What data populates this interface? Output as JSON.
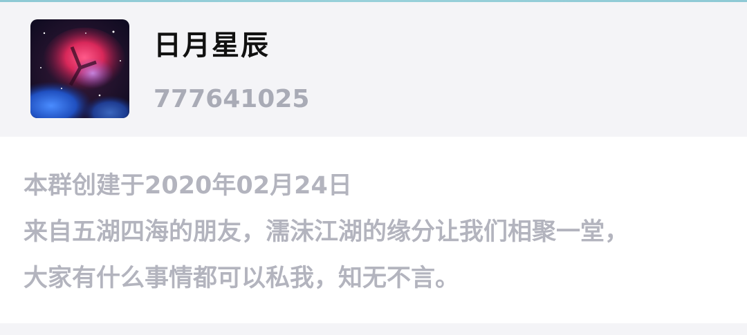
{
  "group": {
    "name": "日月星辰",
    "id": "777641025",
    "avatar_icon": "nebula-avatar"
  },
  "intro": {
    "line1": "本群创建于2020年02月24日",
    "line2": "来自五湖四海的朋友，濡沫江湖的缘分让我们相聚一堂，",
    "line3": "大家有什么事情都可以私我，知无不言。"
  },
  "colors": {
    "header_bg": "#f4f4f7",
    "card_bg": "#ffffff",
    "name_text": "#111111",
    "secondary_text": "#b3b4be"
  }
}
